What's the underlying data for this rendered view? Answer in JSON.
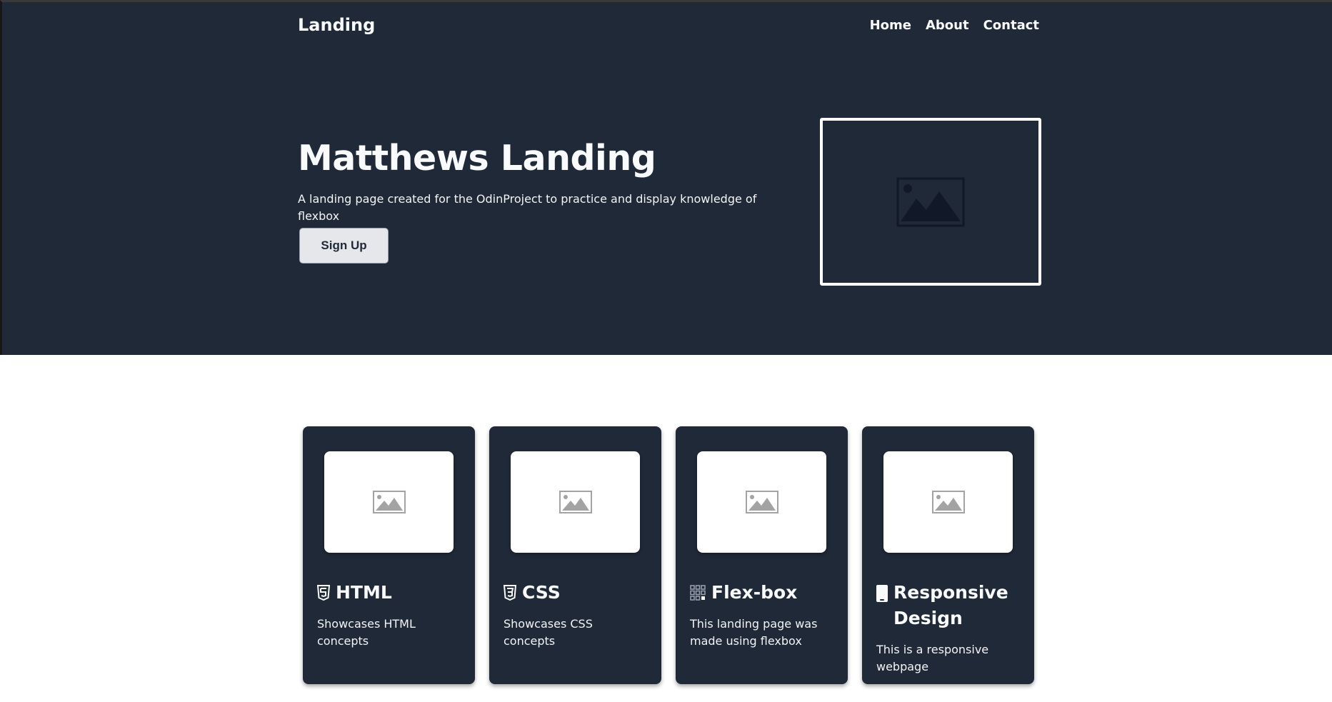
{
  "nav": {
    "brand": "Landing",
    "links": [
      "Home",
      "About",
      "Contact"
    ]
  },
  "hero": {
    "title": "Matthews Landing",
    "description": "A landing page created for the OdinProject to practice and display knowledge of flexbox",
    "button_label": "Sign Up",
    "image_icon": "image-placeholder-icon"
  },
  "cards": [
    {
      "icon": "html5-icon",
      "heading": "HTML",
      "text": "Showcases HTML concepts"
    },
    {
      "icon": "css3-icon",
      "heading": "CSS",
      "text": "Showcases CSS concepts"
    },
    {
      "icon": "grid-icon",
      "heading": "Flex-box",
      "text": "This landing page was made using flexbox"
    },
    {
      "icon": "mobile-icon",
      "heading": "Responsive Design",
      "text": "This is a responsive webpage"
    }
  ],
  "colors": {
    "hero_bg": "#1f2937",
    "page_bg": "#ffffff",
    "card_bg": "#1f2937",
    "button_bg": "#e5e7eb",
    "text_light": "#f9fafb"
  }
}
